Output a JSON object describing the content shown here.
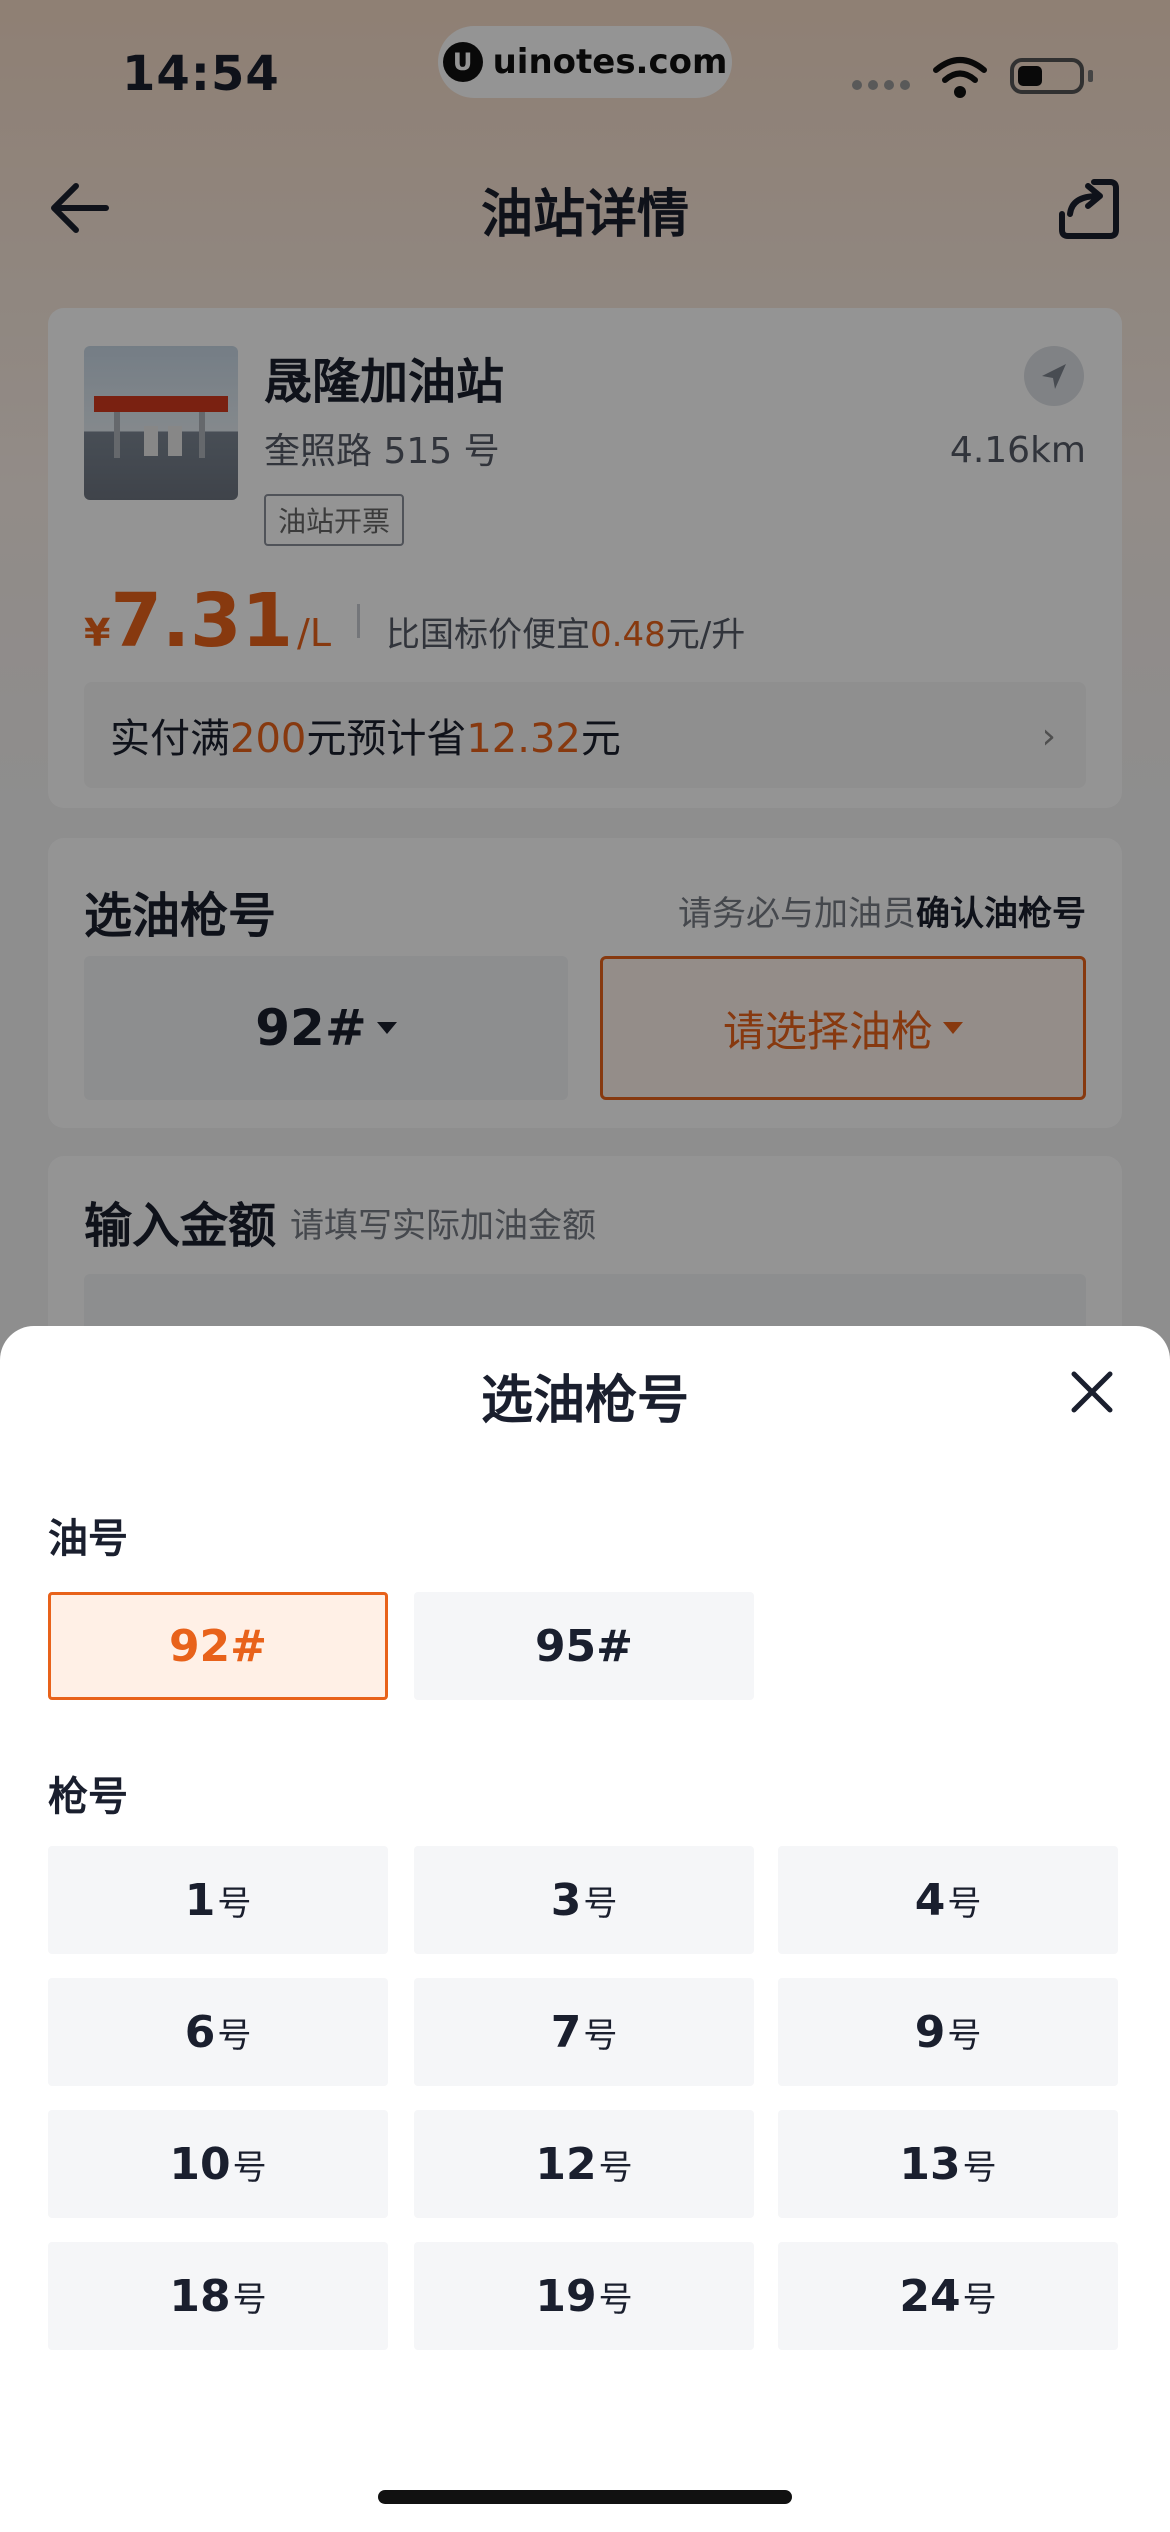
{
  "status_bar": {
    "time": "14:54",
    "url": "uinotes.com",
    "url_logo": "U"
  },
  "nav": {
    "title": "油站详情",
    "back_icon": "back-arrow-icon",
    "share_icon": "share-icon"
  },
  "station": {
    "name": "晟隆加油站",
    "address": "奎照路 515 号",
    "tag": "油站开票",
    "distance": "4.16km",
    "price_symbol": "¥",
    "price": "7.31",
    "price_unit": "/L",
    "compare_prefix": "比国标价便宜",
    "compare_value": "0.48",
    "compare_suffix": "元/升",
    "save_prefix": "实付满",
    "save_amount": "200",
    "save_middle": "元预计省",
    "save_value": "12.32",
    "save_suffix": "元"
  },
  "gun_section": {
    "title": "选油枪号",
    "hint_prefix": "请务必与加油员",
    "hint_bold": "确认油枪号",
    "oil_selected": "92#",
    "gun_placeholder": "请选择油枪"
  },
  "amount_section": {
    "title": "输入金额",
    "hint": "请填写实际加油金额"
  },
  "sheet": {
    "title": "选油枪号",
    "oil_label": "油号",
    "oil_options": [
      "92#",
      "95#"
    ],
    "oil_active": "92#",
    "gun_label": "枪号",
    "gun_suffix": "号",
    "guns": [
      "1",
      "3",
      "4",
      "6",
      "7",
      "9",
      "10",
      "12",
      "13",
      "18",
      "19",
      "24"
    ]
  },
  "colors": {
    "accent": "#e8621a",
    "accent_bg": "#fff0e6",
    "text": "#1a1f2e"
  }
}
